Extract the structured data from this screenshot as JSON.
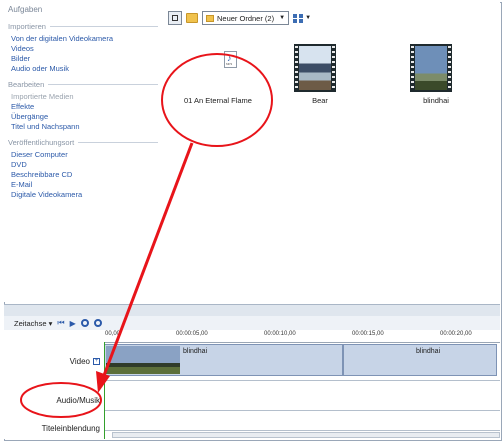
{
  "tasks": {
    "heading": "Aufgaben",
    "sections": [
      {
        "title": "Importieren",
        "links": [
          "Von der digitalen Videokamera",
          "Videos",
          "Bilder",
          "Audio oder Musik"
        ]
      },
      {
        "title": "Bearbeiten",
        "links": [
          "Importierte Medien",
          "Effekte",
          "Übergänge",
          "Titel und Nachspann"
        ]
      },
      {
        "title": "Veröffentlichungsort",
        "links": [
          "Dieser Computer",
          "DVD",
          "Beschreibbare CD",
          "E-Mail",
          "Digitale Videokamera"
        ]
      }
    ]
  },
  "toolbar": {
    "folder_dropdown": "Neuer Ordner (2)"
  },
  "media_items": [
    {
      "label": "01 An Eternal Flame",
      "type": "audio",
      "icon": "mp3-file-icon",
      "badge": "MP3"
    },
    {
      "label": "Bear",
      "type": "video"
    },
    {
      "label": "blindhai",
      "type": "video"
    }
  ],
  "timeline": {
    "mode": "Zeitachse",
    "ruler": [
      "00,00",
      "00:00:05,00",
      "00:00:10,00",
      "00:00:15,00",
      "00:00:20,00"
    ],
    "tracks": {
      "video": "Video",
      "audio": "Audio/Musik",
      "title": "Titeleinblendung"
    },
    "clips": [
      "blindhai",
      "blindhai"
    ]
  },
  "colors": {
    "link": "#2c5aa9",
    "annotation": "#e8141a",
    "playhead": "#33a02c"
  }
}
